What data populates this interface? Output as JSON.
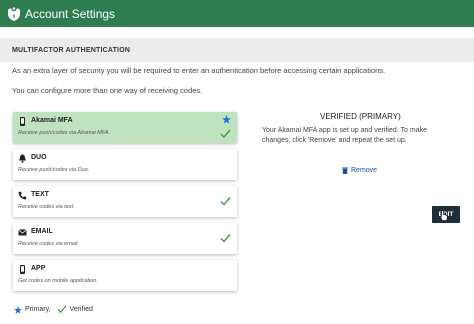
{
  "header": {
    "title": "Account Settings",
    "icon": "shield-icon"
  },
  "section": {
    "title": "MULTIFACTOR AUTHENTICATION"
  },
  "intro": {
    "line1": "As an extra layer of security you will be required to enter an authentication before accessing certain applications.",
    "line2": "You can configure more than one way of receiving codes."
  },
  "methods": [
    {
      "name": "Akamai MFA",
      "desc": "Receive push/codes via Akamai MFA.",
      "icon": "phone-icon",
      "selected": true,
      "primary": true,
      "verified": true
    },
    {
      "name": "DUO",
      "desc": "Receive push/codes via Duo.",
      "icon": "bell-icon",
      "selected": false,
      "primary": false,
      "verified": false
    },
    {
      "name": "TEXT",
      "desc": "Receive codes via text.",
      "icon": "phone-call-icon",
      "selected": false,
      "primary": false,
      "verified": true
    },
    {
      "name": "EMAIL",
      "desc": "Receive codes via email.",
      "icon": "envelope-icon",
      "selected": false,
      "primary": false,
      "verified": true
    },
    {
      "name": "APP",
      "desc": "Get codes on mobile application.",
      "icon": "mobile-icon",
      "selected": false,
      "primary": false,
      "verified": false
    }
  ],
  "detail": {
    "title": "VERIFIED (PRIMARY)",
    "text": "Your Akamai MFA app is set up and verified. To make changes, click 'Remove' and repeat the set up.",
    "remove_label": "Remove",
    "edit_label": "EDIT"
  },
  "legend": {
    "primary_label": "Primary,",
    "verified_label": "Verified"
  },
  "colors": {
    "header_bg": "#2e7d4f",
    "selected_bg": "#bfe3bf",
    "check": "#3aa043",
    "star": "#1f73c9",
    "link": "#1a4fa0",
    "button_bg": "#1e2f3a"
  }
}
